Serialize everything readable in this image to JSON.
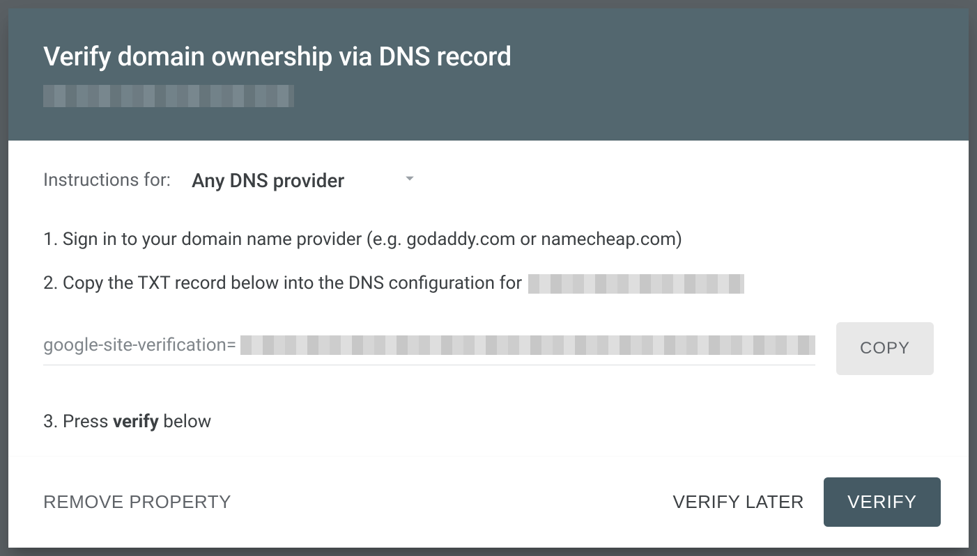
{
  "modal": {
    "title": "Verify domain ownership via DNS record",
    "instructions_label": "Instructions for:",
    "provider_selected": "Any DNS provider",
    "step1": "1. Sign in to your domain name provider (e.g. godaddy.com or namecheap.com)",
    "step2_prefix": "2. Copy the TXT record below into the DNS configuration for ",
    "txt_prefix": "google-site-verification=",
    "copy_label": "COPY",
    "step3_prefix": "3. Press ",
    "step3_bold": "verify",
    "step3_suffix": " below",
    "footer": {
      "remove_property": "REMOVE PROPERTY",
      "verify_later": "VERIFY LATER",
      "verify": "VERIFY"
    }
  }
}
